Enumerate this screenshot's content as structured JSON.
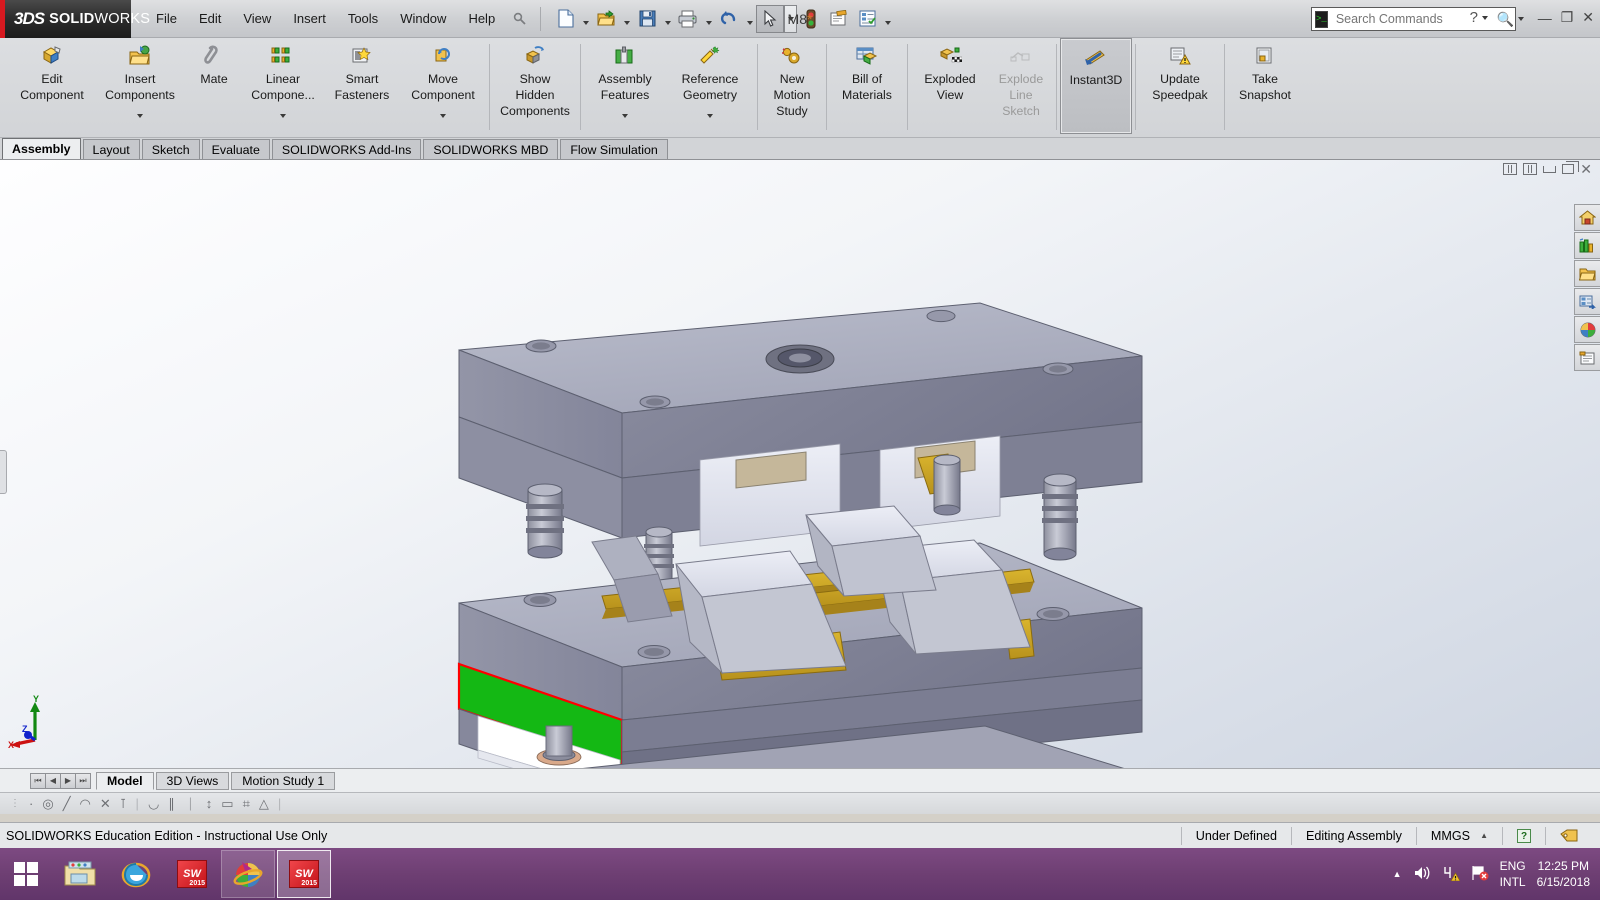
{
  "titlebar": {
    "brand_3ds": "3DS",
    "brand_solid": "SOLID",
    "brand_works": "WORKS",
    "document_title": "M8",
    "document_modified_marker": "*",
    "menu": [
      {
        "label": "File"
      },
      {
        "label": "Edit"
      },
      {
        "label": "View"
      },
      {
        "label": "Insert"
      },
      {
        "label": "Tools"
      },
      {
        "label": "Window"
      },
      {
        "label": "Help"
      }
    ],
    "quick_access": [
      {
        "name": "pin-icon",
        "glyph": "☉"
      },
      {
        "name": "new-document-icon",
        "glyph": "⬜"
      },
      {
        "name": "open-document-icon",
        "glyph": "📂"
      },
      {
        "name": "save-icon",
        "glyph": "💾"
      },
      {
        "name": "print-icon",
        "glyph": "🖨"
      },
      {
        "name": "undo-icon",
        "glyph": "↶"
      },
      {
        "name": "select-cursor-icon",
        "glyph": "➤"
      },
      {
        "name": "rebuild-icon",
        "glyph": "🚦"
      },
      {
        "name": "options-file-icon",
        "glyph": "📝"
      },
      {
        "name": "options-icon",
        "glyph": "📋"
      }
    ],
    "search": {
      "placeholder": "Search Commands",
      "icon": "search-icon"
    },
    "help_label": "?",
    "window_controls": {
      "minimize": "—",
      "restore": "❐",
      "close": "✕"
    }
  },
  "ribbon": {
    "buttons": [
      {
        "label": "Edit\nComponent",
        "icon": "edit-component-icon",
        "dropdown": false,
        "disabled": false,
        "active": false
      },
      {
        "label": "Insert\nComponents",
        "icon": "insert-components-icon",
        "dropdown": true,
        "disabled": false,
        "active": false
      },
      {
        "label": "Mate",
        "icon": "mate-icon",
        "dropdown": false,
        "disabled": false,
        "active": false
      },
      {
        "label": "Linear\nCompone...",
        "icon": "linear-component-pattern-icon",
        "dropdown": true,
        "disabled": false,
        "active": false
      },
      {
        "label": "Smart\nFasteners",
        "icon": "smart-fasteners-icon",
        "dropdown": false,
        "disabled": false,
        "active": false
      },
      {
        "label": "Move\nComponent",
        "icon": "move-component-icon",
        "dropdown": true,
        "disabled": false,
        "active": false
      },
      {
        "label": "Show\nHidden\nComponents",
        "icon": "show-hidden-components-icon",
        "dropdown": false,
        "disabled": false,
        "active": false
      },
      {
        "label": "Assembly\nFeatures",
        "icon": "assembly-features-icon",
        "dropdown": true,
        "disabled": false,
        "active": false
      },
      {
        "label": "Reference\nGeometry",
        "icon": "reference-geometry-icon",
        "dropdown": true,
        "disabled": false,
        "active": false
      },
      {
        "label": "New\nMotion\nStudy",
        "icon": "new-motion-study-icon",
        "dropdown": false,
        "disabled": false,
        "active": false
      },
      {
        "label": "Bill of\nMaterials",
        "icon": "bill-of-materials-icon",
        "dropdown": false,
        "disabled": false,
        "active": false
      },
      {
        "label": "Exploded\nView",
        "icon": "exploded-view-icon",
        "dropdown": false,
        "disabled": false,
        "active": false
      },
      {
        "label": "Explode\nLine\nSketch",
        "icon": "explode-line-sketch-icon",
        "dropdown": false,
        "disabled": true,
        "active": false
      },
      {
        "label": "Instant3D",
        "icon": "instant3d-icon",
        "dropdown": false,
        "disabled": false,
        "active": true
      },
      {
        "label": "Update\nSpeedpak",
        "icon": "update-speedpak-icon",
        "dropdown": false,
        "disabled": false,
        "active": false
      },
      {
        "label": "Take\nSnapshot",
        "icon": "take-snapshot-icon",
        "dropdown": false,
        "disabled": false,
        "active": false
      }
    ]
  },
  "command_tabs": [
    {
      "label": "Assembly",
      "active": true
    },
    {
      "label": "Layout",
      "active": false
    },
    {
      "label": "Sketch",
      "active": false
    },
    {
      "label": "Evaluate",
      "active": false
    },
    {
      "label": "SOLIDWORKS Add-Ins",
      "active": false
    },
    {
      "label": "SOLIDWORKS MBD",
      "active": false
    },
    {
      "label": "Flow Simulation",
      "active": false
    }
  ],
  "viewport": {
    "window_controls": [
      {
        "name": "viewport-tile-left-icon",
        "glyph": "▧"
      },
      {
        "name": "viewport-tile-right-icon",
        "glyph": "▨"
      },
      {
        "name": "viewport-minimize-icon",
        "glyph": "—"
      },
      {
        "name": "viewport-restore-icon",
        "glyph": "❐"
      },
      {
        "name": "viewport-close-icon",
        "glyph": "✕"
      }
    ],
    "task_pane": [
      {
        "name": "solidworks-resources-icon",
        "glyph": "🏠"
      },
      {
        "name": "design-library-icon",
        "glyph": "📚"
      },
      {
        "name": "file-explorer-icon",
        "glyph": "📁"
      },
      {
        "name": "view-palette-icon",
        "glyph": "🗂"
      },
      {
        "name": "appearances-scenes-decals-icon",
        "glyph": "🎨"
      },
      {
        "name": "custom-properties-icon",
        "glyph": "📋"
      }
    ],
    "triad": {
      "x_label": "X",
      "y_label": "Y",
      "z_label": "Z",
      "x_color": "#cc1111",
      "y_color": "#118811",
      "z_color": "#1122cc"
    },
    "model": {
      "description": "Exploded injection mold base assembly",
      "body_color": "#9a9cae",
      "body_light": "#c3c5d4",
      "body_dark": "#7e8091",
      "selected_face_color": "#14b814",
      "selection_edge_color": "#ff0000",
      "brass_color": "#c8a21e",
      "highlight_color": "#d9dbe6"
    }
  },
  "bottom_tabs": {
    "nav": [
      {
        "name": "first-tab-button",
        "glyph": "⏮"
      },
      {
        "name": "previous-tab-button",
        "glyph": "◀"
      },
      {
        "name": "next-tab-button",
        "glyph": "▶"
      },
      {
        "name": "last-tab-button",
        "glyph": "⏭"
      }
    ],
    "tabs": [
      {
        "label": "Model",
        "active": true
      },
      {
        "label": "3D Views",
        "active": false
      },
      {
        "label": "Motion Study 1",
        "active": false
      }
    ]
  },
  "sketch_toolbar": [
    {
      "name": "point-icon",
      "glyph": "·"
    },
    {
      "name": "circle-icon",
      "glyph": "◎"
    },
    {
      "name": "line-icon",
      "glyph": "╱"
    },
    {
      "name": "arc-icon",
      "glyph": "◠"
    },
    {
      "name": "coincident-icon",
      "glyph": "✕"
    },
    {
      "name": "perpendicular-icon",
      "glyph": "⊺"
    },
    {
      "name": "tangent-icon",
      "glyph": "◡"
    },
    {
      "name": "parallel-icon",
      "glyph": "∥"
    },
    {
      "name": "equal-icon",
      "glyph": "｜"
    },
    {
      "name": "dimension-icon",
      "glyph": "↕"
    },
    {
      "name": "horizontal-icon",
      "glyph": "▭"
    },
    {
      "name": "grid-icon",
      "glyph": "⌗"
    },
    {
      "name": "angle-icon",
      "glyph": "△"
    }
  ],
  "statusbar": {
    "license_text": "SOLIDWORKS Education Edition - Instructional Use Only",
    "sketch_state": "Under Defined",
    "edit_mode": "Editing Assembly",
    "units": "MMGS",
    "units_caret": "▲",
    "help_icon": "?",
    "tag_icon": "tag-icon"
  },
  "taskbar": {
    "start_button": "start-button",
    "items": [
      {
        "name": "taskbar-file-explorer",
        "icon": "folder-icon",
        "state": "pinned"
      },
      {
        "name": "taskbar-internet-explorer",
        "icon": "internet-explorer-icon",
        "state": "pinned"
      },
      {
        "name": "taskbar-solidworks-2015-a",
        "icon": "solidworks-2015-icon",
        "label": "SW",
        "year": "2015",
        "state": "pinned"
      },
      {
        "name": "taskbar-download-manager",
        "icon": "download-manager-icon",
        "state": "open"
      },
      {
        "name": "taskbar-solidworks-2015-b",
        "icon": "solidworks-2015-icon",
        "label": "SW",
        "year": "2015",
        "state": "focus"
      }
    ],
    "tray": {
      "show_hidden": "▲",
      "volume_icon": "speaker-icon",
      "network_icon": "network-warning-icon",
      "action_center_icon": "flag-error-icon",
      "language_line1": "ENG",
      "language_line2": "INTL",
      "time": "12:25 PM",
      "date": "6/15/2018"
    }
  }
}
